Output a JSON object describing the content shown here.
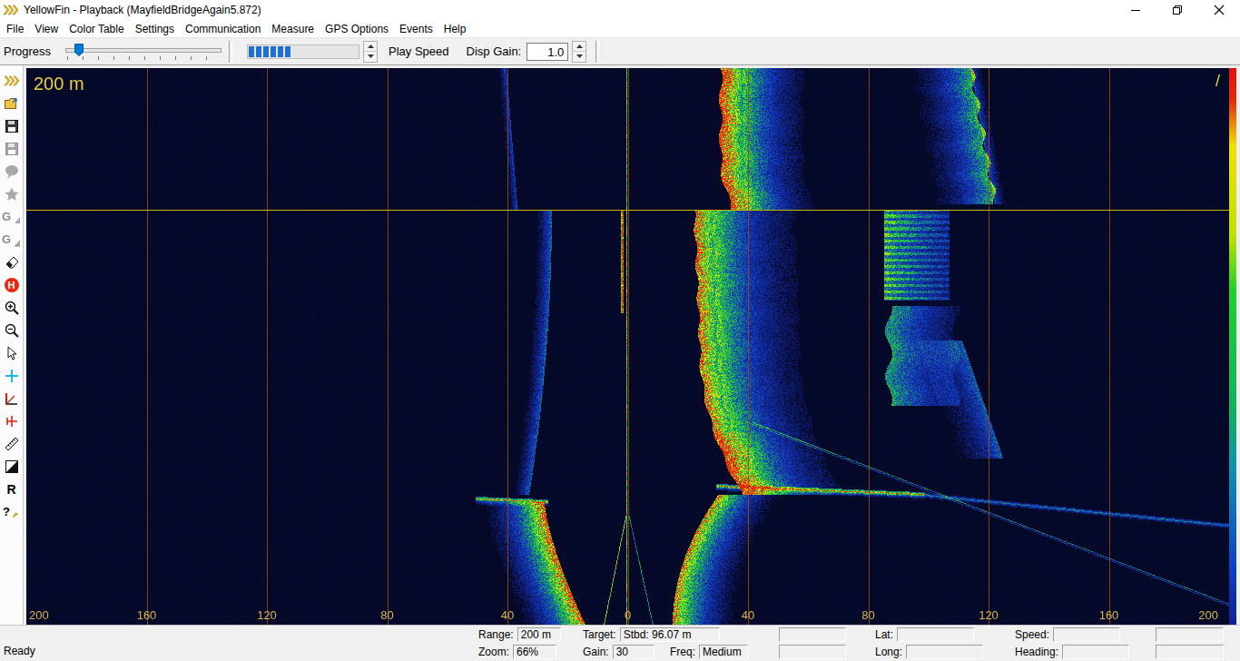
{
  "window": {
    "title": "YellowFin - Playback (MayfieldBridgeAgain5.872)"
  },
  "menu": [
    "File",
    "View",
    "Color Table",
    "Settings",
    "Communication",
    "Measure",
    "GPS Options",
    "Events",
    "Help"
  ],
  "toolbar": {
    "progress_label": "Progress",
    "progress": {
      "level": 0.08
    },
    "buffer": {
      "level": 0.38
    },
    "play_speed_label": "Play Speed",
    "disp_gain_label": "Disp Gain:",
    "disp_gain_value": "1.0"
  },
  "side_tools": [
    {
      "kind": "arrows",
      "disabled": false
    },
    {
      "kind": "open",
      "disabled": false
    },
    {
      "kind": "save",
      "disabled": false
    },
    {
      "kind": "saveas",
      "disabled": true
    },
    {
      "kind": "balloon",
      "disabled": true
    },
    {
      "kind": "star",
      "disabled": true
    },
    {
      "kind": "gain",
      "label": "G",
      "disabled": true
    },
    {
      "kind": "gain2",
      "label": "G",
      "disabled": true
    },
    {
      "kind": "eraser",
      "disabled": false
    },
    {
      "kind": "hold",
      "label": "H",
      "disabled": false
    },
    {
      "kind": "zoomin",
      "disabled": false
    },
    {
      "kind": "zoomout",
      "disabled": false
    },
    {
      "kind": "pointer",
      "disabled": false
    },
    {
      "kind": "cross",
      "disabled": false
    },
    {
      "kind": "range",
      "disabled": false
    },
    {
      "kind": "offset",
      "disabled": false
    },
    {
      "kind": "ruler",
      "disabled": false
    },
    {
      "kind": "contrast",
      "disabled": false
    },
    {
      "kind": "reset",
      "label": "R",
      "disabled": false
    },
    {
      "kind": "help",
      "label": "?",
      "disabled": false
    }
  ],
  "sonar": {
    "range_label": "200 m",
    "corner_mark": "/",
    "ticks": [
      "200",
      "160",
      "120",
      "80",
      "40",
      "0",
      "40",
      "80",
      "120",
      "160",
      "200"
    ]
  },
  "status_bar": {
    "message": "Ready",
    "rows": [
      [
        {
          "label": "Range:",
          "value": "200 m"
        },
        {
          "label": "Target:",
          "value": "Stbd: 96.07 m"
        },
        {
          "label": "",
          "value": ""
        },
        {
          "label": "Lat:",
          "value": ""
        },
        {
          "label": "Speed:",
          "value": ""
        },
        {
          "label": "",
          "value": ""
        }
      ],
      [
        {
          "label": "Zoom:",
          "value": "66%"
        },
        {
          "label": "Gain:",
          "value": "30"
        },
        {
          "label": "Freq:",
          "value": "Medium"
        },
        {
          "label": "",
          "value": ""
        },
        {
          "label": "Long:",
          "value": ""
        },
        {
          "label": "Heading:",
          "value": ""
        },
        {
          "label": "",
          "value": ""
        }
      ]
    ]
  }
}
